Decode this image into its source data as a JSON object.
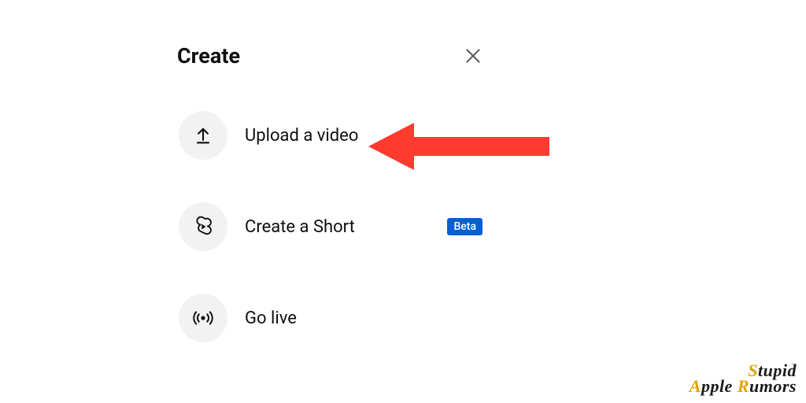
{
  "sheet": {
    "title": "Create",
    "options": [
      {
        "label": "Upload a video",
        "badge": null
      },
      {
        "label": "Create a Short",
        "badge": "Beta"
      },
      {
        "label": "Go live",
        "badge": null
      }
    ]
  },
  "watermark": {
    "line1_s": "S",
    "line1_rest": "tupid",
    "line2_a": "A",
    "line2_mid": "pple ",
    "line2_r": "R",
    "line2_end": "umors"
  },
  "annotation": {
    "arrow_color": "#ff3b30"
  }
}
